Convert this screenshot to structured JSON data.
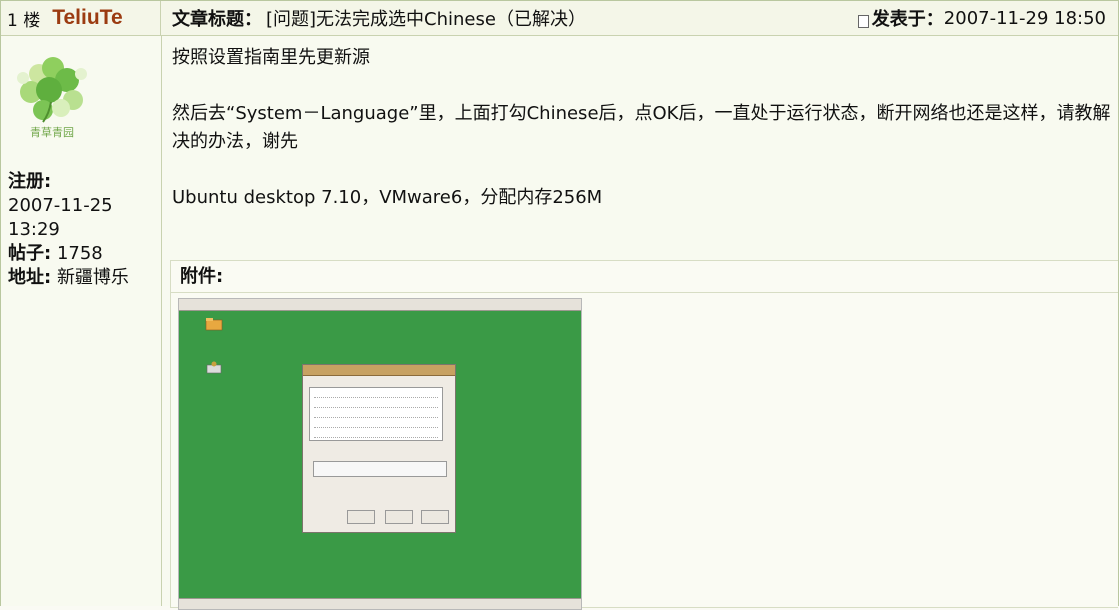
{
  "header": {
    "floor": "1 楼",
    "author": "TeliuTe",
    "title_label": "文章标题：",
    "title": "[问题]无法完成选中Chinese（已解决）",
    "posted_label": "发表于：",
    "posted_time": "2007-11-29 18:50"
  },
  "user": {
    "avatar_caption": "青草青园",
    "reg_label": "注册:",
    "reg_date": "2007-11-25",
    "reg_time": "13:29",
    "posts_label": "帖子:",
    "posts_count": "1758",
    "location_label": "地址:",
    "location": "新疆博乐"
  },
  "body": {
    "p1": "按照设置指南里先更新源",
    "p2": "然后去“System－Language”里，上面打勾Chinese后，点OK后，一直处于运行状态，断开网络也还是这样，请教解决的办法，谢先",
    "p3": "Ubuntu desktop 7.10，VMware6，分配内存256M"
  },
  "attachment": {
    "label": "附件:"
  },
  "colors": {
    "author": "#9b3b11",
    "border": "#c9d2b0",
    "header_bg": "#f4f6e8",
    "desktop_green": "#3a9a46"
  },
  "icons": {
    "post_icon": "document-icon",
    "avatar": "clover-avatar"
  }
}
